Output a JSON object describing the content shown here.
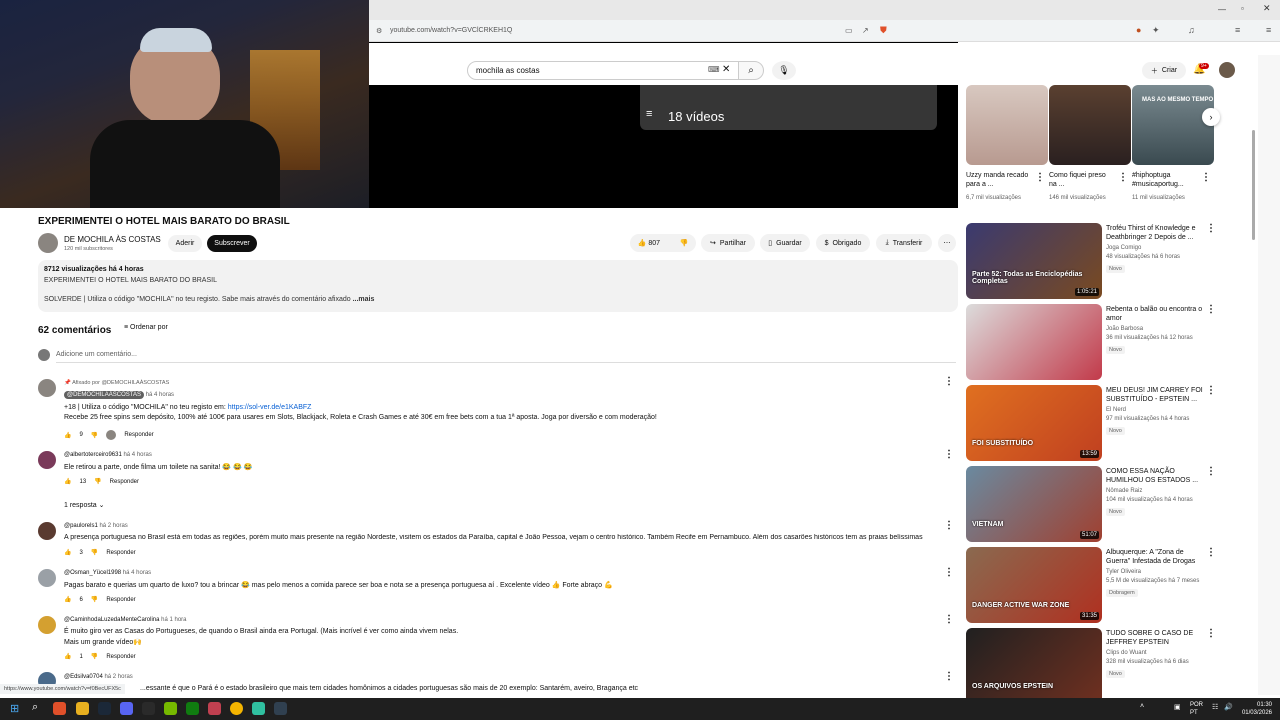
{
  "browser": {
    "url": "youtube.com/watch?v=GVClCRKEH1Q",
    "status_url": "https://www.youtube.com/watch?v=f0BecUFX5c"
  },
  "header": {
    "search_value": "mochila as costas",
    "create_label": "Criar",
    "notif_count": "9+"
  },
  "player": {
    "playlist_count": "18 vídeos"
  },
  "video": {
    "title": "EXPERIMENTEI O HOTEL MAIS BARATO DO BRASIL",
    "channel": "DE MOCHILA ÀS COSTAS",
    "subscribers": "120 mil subscritores",
    "join_label": "Aderir",
    "subscribe_label": "Subscrever",
    "likes": "807",
    "share_label": "Partilhar",
    "save_label": "Guardar",
    "thanks_label": "Obrigado",
    "download_label": "Transferir",
    "stats": "8712 visualizações  há 4 horas",
    "desc_line1": "EXPERIMENTEI O HOTEL MAIS BARATO DO BRASIL",
    "desc_line2": "SOLVERDE | Utiliza o código \"MOCHILA\" no teu registo. Sabe mais através do comentário afixado",
    "more_label": "...mais"
  },
  "comments": {
    "count_label": "62 comentários",
    "sort_label": "Ordenar por",
    "add_placeholder": "Adicione um comentário...",
    "items": [
      {
        "pinned": "Afixado por @DEMOCHILAÀSCOSTAS",
        "author": "@DEMOCHILAÀSCOSTAS",
        "time": "há 4 horas",
        "line1": "+18 | Utiliza o código \"MOCHILA\" no teu registo em: ",
        "link": "https://sol-ver.de/e1KABFZ",
        "line2": "Recebe 25 free spins sem depósito, 100% até 100€ para usares em Slots, Blackjack, Roleta e Crash Games e até 30€ em free bets com a tua 1ª aposta. Joga por diversão e com moderação!",
        "likes": "9",
        "reply": "Responder"
      },
      {
        "author": "@albertoterceiro9631",
        "time": "há 4 horas",
        "line1": "Ele retirou a parte, onde filma um toilete na sanita! 😂 😂 😂",
        "likes": "13",
        "reply": "Responder",
        "replies": "1 resposta"
      },
      {
        "author": "@paulorels1",
        "time": "há 2 horas",
        "line1": "A presença portuguesa no Brasil está em todas as regiões, porém muito mais presente na região Nordeste, visitem os estados da Paraíba, capital é João Pessoa, vejam o centro histórico. Também Recife em Pernambuco.  Além dos casarões históricos tem as praias belíssimas",
        "likes": "3",
        "reply": "Responder"
      },
      {
        "author": "@Osman_Yücel1998",
        "time": "há 4 horas",
        "line1": "Pagas barato e querias um quarto de luxo?  tou a brincar 😂  mas pelo menos a comida parece ser boa e nota se a presença portuguesa aí . Excelente vídeo 👍 Forte abraço 💪",
        "likes": "6",
        "reply": "Responder"
      },
      {
        "author": "@CaminhodaLuzedaMenteCarolina",
        "time": "há 1 hora",
        "line1": "É muito giro ver as Casas do Portugueses, de quando o Brasil ainda era Portugal. (Mais incrível é ver como ainda vivem nelas.",
        "line2": "Mais um grande vídeo🙌",
        "likes": "1",
        "reply": "Responder"
      },
      {
        "author": "@Edsilva0704",
        "time": "há 2 horas",
        "line1": "...essante é que o Pará é o estado brasileiro que mais tem cidades homônimos a cidades portuguesas são mais de 20 exemplo: Santarém, aveiro, Bragança etc"
      }
    ]
  },
  "shorts": [
    {
      "title": "Uzzy manda recado para a ...",
      "meta": "6,7 mil visualizações"
    },
    {
      "title": "Como fiquei preso na ...",
      "meta": "146 mil visualizações"
    },
    {
      "title": "#hiphoptuga #musicaportug...",
      "meta": "11 mil visualizações",
      "overlay": "MAS AO MESMO TEMPO"
    }
  ],
  "recommendations": [
    {
      "title": "Troféu Thirst of Knowledge e Deathbringer 2 Depois de ...",
      "channel": "Joga Comigo",
      "meta": "48 visualizações  há 6 horas",
      "badge": "Novo",
      "duration": "1:05:21",
      "thumb_text": "Parte 52: Todas as Enciclopédias Completas",
      "colors": [
        "#3a3a70",
        "#7a4a20"
      ]
    },
    {
      "title": "Rebenta o balão ou encontra o amor",
      "channel": "João Barbosa",
      "meta": "36 mil visualizações  há 12 horas",
      "badge": "Novo",
      "duration": "",
      "thumb_text": "",
      "colors": [
        "#dcdcdc",
        "#c23a4a"
      ]
    },
    {
      "title": "MEU DEUS! JIM CARREY FOI SUBSTITUÍDO - EPSTEIN ...",
      "channel": "El Nerd",
      "meta": "97 mil visualizações  há 4 horas",
      "badge": "Novo",
      "duration": "13:59",
      "thumb_text": "FOI SUBSTITUÍDO",
      "colors": [
        "#e07020",
        "#c04020"
      ]
    },
    {
      "title": "COMO ESSA NAÇÃO HUMILHOU OS ESTADOS ...",
      "channel": "Nômade Raiz",
      "meta": "104 mil visualizações  há 4 horas",
      "badge": "Novo",
      "duration": "51:07",
      "thumb_text": "VIETNAM",
      "colors": [
        "#6a8aa0",
        "#a04030"
      ]
    },
    {
      "title": "Albuquerque: A \"Zona de Guerra\" Infestada de Drogas",
      "channel": "Tyler Oliveira",
      "meta": "5,5 M de visualizações  há 7 meses",
      "badge": "Dobragem",
      "duration": "31:35",
      "thumb_text": "DANGER ACTIVE WAR ZONE",
      "colors": [
        "#8a6a50",
        "#b03020"
      ]
    },
    {
      "title": "TUDO SOBRE O CASO DE JEFFREY EPSTEIN",
      "channel": "Clips do Wuant",
      "meta": "328 mil visualizações  há 6 dias",
      "badge": "Novo",
      "duration": "",
      "thumb_text": "OS ARQUIVOS EPSTEIN",
      "colors": [
        "#202020",
        "#703020"
      ]
    }
  ],
  "taskbar": {
    "lang1": "POR",
    "lang2": "PT",
    "time": "01:30",
    "date": "01/03/2026"
  }
}
